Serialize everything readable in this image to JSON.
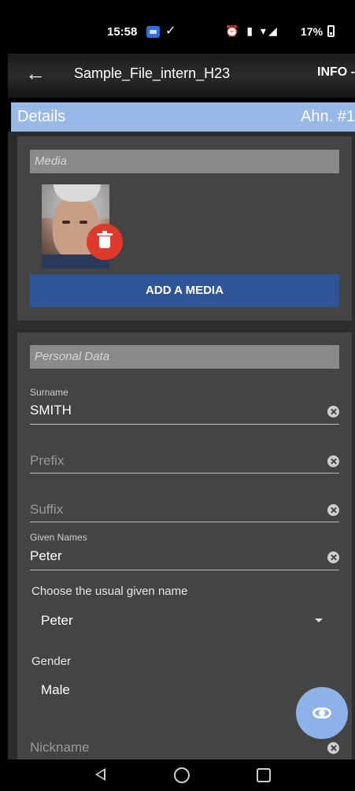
{
  "status_bar": {
    "time": "15:58",
    "check_glyph": "✓",
    "icons": "⏰ ▮ ▾◢",
    "battery": "17%"
  },
  "app_bar": {
    "back_icon": "←",
    "title": "Sample_File_intern_H23",
    "info": "INFO -"
  },
  "details_header": {
    "label": "Details",
    "id": "Ahn. #1"
  },
  "media": {
    "section": "Media",
    "add_button": "ADD A MEDIA"
  },
  "personal": {
    "section": "Personal Data",
    "surname_label": "Surname",
    "surname": "SMITH",
    "prefix_placeholder": "Prefix",
    "suffix_placeholder": "Suffix",
    "given_label": "Given Names",
    "given": "Peter",
    "usual_label": "Choose the usual given name",
    "usual_value": "Peter",
    "gender_label": "Gender",
    "gender_value": "Male",
    "nickname_placeholder": "Nickname"
  },
  "colors": {
    "details_bar": "#98b9e8",
    "add_media": "#2f5597",
    "trash": "#e0382b",
    "fab": "#8fb1ea"
  },
  "icons": {
    "fab": "eye-icon",
    "trash": "trash-icon"
  }
}
